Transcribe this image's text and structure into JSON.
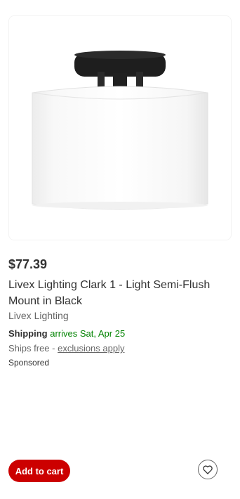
{
  "product": {
    "price": "$77.39",
    "title": "Livex Lighting Clark 1 - Light Semi-Flush Mount in Black",
    "brand": "Livex Lighting",
    "image_icon": "ceiling-light-product-image"
  },
  "shipping": {
    "label": "Shipping",
    "arrives": "arrives Sat, Apr 25",
    "ships_free": "Ships free - ",
    "exclusions_link": "exclusions apply"
  },
  "sponsored": "Sponsored",
  "actions": {
    "add_to_cart": "Add to cart",
    "favorite_icon": "heart-icon"
  },
  "colors": {
    "primary_button": "#cc0000",
    "arrival_text": "#008300"
  }
}
